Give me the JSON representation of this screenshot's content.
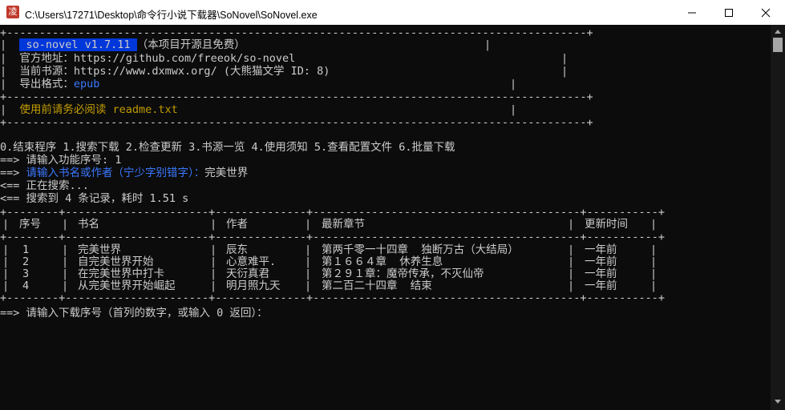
{
  "window": {
    "title": "C:\\Users\\17271\\Desktop\\命令行小说下载器\\SoNovel\\SoNovel.exe",
    "app_icon_glyph": "凌",
    "buttons": {
      "minimize": "minimize-icon",
      "maximize": "maximize-icon",
      "close": "close-icon"
    }
  },
  "colors": {
    "background": "#0c0c0c",
    "text": "#cccccc",
    "blue": "#3b78ff",
    "yellow": "#c19c00",
    "highlight": "#0037da"
  },
  "banner": {
    "border_top": "+-----------------------------------------------------------------------------------------+",
    "line1_pre": "|  ",
    "app_name": " so-novel v1.7.11 ",
    "line1_desc": "（本项目开源且免费）",
    "line1_tail": "|",
    "line2": "|  官方地址：https://github.com/freeok/so-novel",
    "line2_tail": "|",
    "line3": "|  当前书源：https://www.dxmwx.org/ (大熊猫文学 ID: 8)",
    "line3_tail": "|",
    "line4_label": "|  导出格式：",
    "line4_value": "epub",
    "line4_tail": "|",
    "border_mid": "+-----------------------------------------------------------------------------------------+",
    "notice_pre": "|  ",
    "notice": "使用前请务必阅读 readme.txt",
    "notice_tail": "|",
    "border_bottom": "+-----------------------------------------------------------------------------------------+"
  },
  "menu": "0.结束程序 1.搜索下载 2.检查更新 3.书源一览 4.使用须知 5.查看配置文件 6.批量下载",
  "prompt1": "==> 请输入功能序号: 1",
  "prompt2_arrow": "==> ",
  "prompt2_label": "请输入书名或作者（宁少字别错字）：",
  "prompt2_value": "完美世界",
  "status1": "<== 正在搜索...",
  "status2": "<== 搜索到 4 条记录，耗时 1.51 s",
  "table": {
    "border": "+--------+----------------------+--------------+-----------------------------------------+-----------+",
    "headers": [
      "序号",
      "书名",
      "作者",
      "最新章节",
      "更新时间"
    ],
    "rows": [
      [
        "1",
        "完美世界",
        "辰东",
        "第两千零一十四章  独断万古（大结局）",
        "一年前"
      ],
      [
        "2",
        "自完美世界开始",
        "心意难平.",
        "第１６６４章  休养生息",
        "一年前"
      ],
      [
        "3",
        "在完美世界中打卡",
        "天衍真君",
        "第２９１章：魔帝传承，不灭仙帝",
        "一年前"
      ],
      [
        "4",
        "从完美世界开始崛起",
        "明月照九天",
        "第二百二十四章  结束",
        "一年前"
      ]
    ]
  },
  "final_prompt": "==> 请输入下载序号（首列的数字，或输入 0 返回）："
}
